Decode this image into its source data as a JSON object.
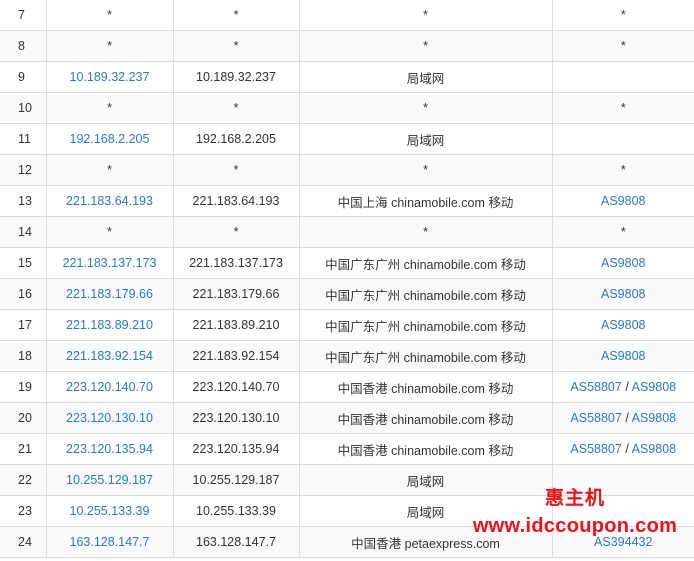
{
  "hops": [
    {
      "hop": "7",
      "ip": "*",
      "host": "*",
      "location": "*",
      "asn": "*"
    },
    {
      "hop": "8",
      "ip": "*",
      "host": "*",
      "location": "*",
      "asn": "*"
    },
    {
      "hop": "9",
      "ip": "10.189.32.237",
      "host": "10.189.32.237",
      "location": "局域网",
      "asn": ""
    },
    {
      "hop": "10",
      "ip": "*",
      "host": "*",
      "location": "*",
      "asn": "*"
    },
    {
      "hop": "11",
      "ip": "192.168.2.205",
      "host": "192.168.2.205",
      "location": "局域网",
      "asn": ""
    },
    {
      "hop": "12",
      "ip": "*",
      "host": "*",
      "location": "*",
      "asn": "*"
    },
    {
      "hop": "13",
      "ip": "221.183.64.193",
      "host": "221.183.64.193",
      "location": "中国上海 chinamobile.com 移动",
      "asn": "AS9808"
    },
    {
      "hop": "14",
      "ip": "*",
      "host": "*",
      "location": "*",
      "asn": "*"
    },
    {
      "hop": "15",
      "ip": "221.183.137.173",
      "host": "221.183.137.173",
      "location": "中国广东广州 chinamobile.com 移动",
      "asn": "AS9808"
    },
    {
      "hop": "16",
      "ip": "221.183.179.66",
      "host": "221.183.179.66",
      "location": "中国广东广州 chinamobile.com 移动",
      "asn": "AS9808"
    },
    {
      "hop": "17",
      "ip": "221.183.89.210",
      "host": "221.183.89.210",
      "location": "中国广东广州 chinamobile.com 移动",
      "asn": "AS9808"
    },
    {
      "hop": "18",
      "ip": "221.183.92.154",
      "host": "221.183.92.154",
      "location": "中国广东广州 chinamobile.com 移动",
      "asn": "AS9808"
    },
    {
      "hop": "19",
      "ip": "223.120.140.70",
      "host": "223.120.140.70",
      "location": "中国香港 chinamobile.com 移动",
      "asn": "AS58807",
      "asn2": "AS9808"
    },
    {
      "hop": "20",
      "ip": "223.120.130.10",
      "host": "223.120.130.10",
      "location": "中国香港 chinamobile.com 移动",
      "asn": "AS58807",
      "asn2": "AS9808"
    },
    {
      "hop": "21",
      "ip": "223.120.135.94",
      "host": "223.120.135.94",
      "location": "中国香港 chinamobile.com 移动",
      "asn": "AS58807",
      "asn2": "AS9808"
    },
    {
      "hop": "22",
      "ip": "10.255.129.187",
      "host": "10.255.129.187",
      "location": "局域网",
      "asn": ""
    },
    {
      "hop": "23",
      "ip": "10.255.133.39",
      "host": "10.255.133.39",
      "location": "局域网",
      "asn": ""
    },
    {
      "hop": "24",
      "ip": "163.128.147.7",
      "host": "163.128.147.7",
      "location": "中国香港 petaexpress.com",
      "asn": "AS394432"
    }
  ],
  "asn_separator": "/",
  "watermark": {
    "brand": "惠主机",
    "url": "www.idccoupon.com"
  },
  "colors": {
    "link": "#2b78c5",
    "text": "#333333",
    "border": "#dcdcdc",
    "stripe": "#f9f9f9",
    "watermark": "#e8141a"
  }
}
